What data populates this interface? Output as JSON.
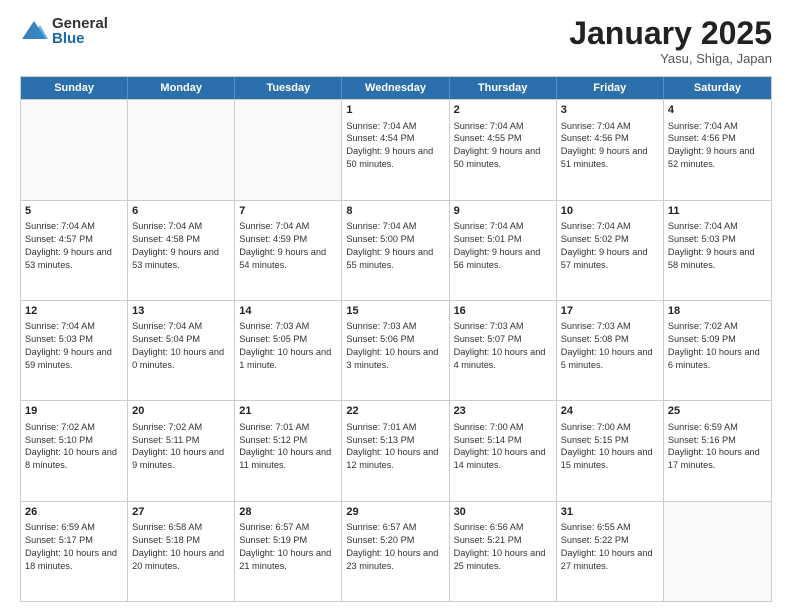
{
  "logo": {
    "general": "General",
    "blue": "Blue"
  },
  "title": "January 2025",
  "subtitle": "Yasu, Shiga, Japan",
  "headers": [
    "Sunday",
    "Monday",
    "Tuesday",
    "Wednesday",
    "Thursday",
    "Friday",
    "Saturday"
  ],
  "weeks": [
    [
      {
        "day": "",
        "text": ""
      },
      {
        "day": "",
        "text": ""
      },
      {
        "day": "",
        "text": ""
      },
      {
        "day": "1",
        "text": "Sunrise: 7:04 AM\nSunset: 4:54 PM\nDaylight: 9 hours and 50 minutes."
      },
      {
        "day": "2",
        "text": "Sunrise: 7:04 AM\nSunset: 4:55 PM\nDaylight: 9 hours and 50 minutes."
      },
      {
        "day": "3",
        "text": "Sunrise: 7:04 AM\nSunset: 4:56 PM\nDaylight: 9 hours and 51 minutes."
      },
      {
        "day": "4",
        "text": "Sunrise: 7:04 AM\nSunset: 4:56 PM\nDaylight: 9 hours and 52 minutes."
      }
    ],
    [
      {
        "day": "5",
        "text": "Sunrise: 7:04 AM\nSunset: 4:57 PM\nDaylight: 9 hours and 53 minutes."
      },
      {
        "day": "6",
        "text": "Sunrise: 7:04 AM\nSunset: 4:58 PM\nDaylight: 9 hours and 53 minutes."
      },
      {
        "day": "7",
        "text": "Sunrise: 7:04 AM\nSunset: 4:59 PM\nDaylight: 9 hours and 54 minutes."
      },
      {
        "day": "8",
        "text": "Sunrise: 7:04 AM\nSunset: 5:00 PM\nDaylight: 9 hours and 55 minutes."
      },
      {
        "day": "9",
        "text": "Sunrise: 7:04 AM\nSunset: 5:01 PM\nDaylight: 9 hours and 56 minutes."
      },
      {
        "day": "10",
        "text": "Sunrise: 7:04 AM\nSunset: 5:02 PM\nDaylight: 9 hours and 57 minutes."
      },
      {
        "day": "11",
        "text": "Sunrise: 7:04 AM\nSunset: 5:03 PM\nDaylight: 9 hours and 58 minutes."
      }
    ],
    [
      {
        "day": "12",
        "text": "Sunrise: 7:04 AM\nSunset: 5:03 PM\nDaylight: 9 hours and 59 minutes."
      },
      {
        "day": "13",
        "text": "Sunrise: 7:04 AM\nSunset: 5:04 PM\nDaylight: 10 hours and 0 minutes."
      },
      {
        "day": "14",
        "text": "Sunrise: 7:03 AM\nSunset: 5:05 PM\nDaylight: 10 hours and 1 minute."
      },
      {
        "day": "15",
        "text": "Sunrise: 7:03 AM\nSunset: 5:06 PM\nDaylight: 10 hours and 3 minutes."
      },
      {
        "day": "16",
        "text": "Sunrise: 7:03 AM\nSunset: 5:07 PM\nDaylight: 10 hours and 4 minutes."
      },
      {
        "day": "17",
        "text": "Sunrise: 7:03 AM\nSunset: 5:08 PM\nDaylight: 10 hours and 5 minutes."
      },
      {
        "day": "18",
        "text": "Sunrise: 7:02 AM\nSunset: 5:09 PM\nDaylight: 10 hours and 6 minutes."
      }
    ],
    [
      {
        "day": "19",
        "text": "Sunrise: 7:02 AM\nSunset: 5:10 PM\nDaylight: 10 hours and 8 minutes."
      },
      {
        "day": "20",
        "text": "Sunrise: 7:02 AM\nSunset: 5:11 PM\nDaylight: 10 hours and 9 minutes."
      },
      {
        "day": "21",
        "text": "Sunrise: 7:01 AM\nSunset: 5:12 PM\nDaylight: 10 hours and 11 minutes."
      },
      {
        "day": "22",
        "text": "Sunrise: 7:01 AM\nSunset: 5:13 PM\nDaylight: 10 hours and 12 minutes."
      },
      {
        "day": "23",
        "text": "Sunrise: 7:00 AM\nSunset: 5:14 PM\nDaylight: 10 hours and 14 minutes."
      },
      {
        "day": "24",
        "text": "Sunrise: 7:00 AM\nSunset: 5:15 PM\nDaylight: 10 hours and 15 minutes."
      },
      {
        "day": "25",
        "text": "Sunrise: 6:59 AM\nSunset: 5:16 PM\nDaylight: 10 hours and 17 minutes."
      }
    ],
    [
      {
        "day": "26",
        "text": "Sunrise: 6:59 AM\nSunset: 5:17 PM\nDaylight: 10 hours and 18 minutes."
      },
      {
        "day": "27",
        "text": "Sunrise: 6:58 AM\nSunset: 5:18 PM\nDaylight: 10 hours and 20 minutes."
      },
      {
        "day": "28",
        "text": "Sunrise: 6:57 AM\nSunset: 5:19 PM\nDaylight: 10 hours and 21 minutes."
      },
      {
        "day": "29",
        "text": "Sunrise: 6:57 AM\nSunset: 5:20 PM\nDaylight: 10 hours and 23 minutes."
      },
      {
        "day": "30",
        "text": "Sunrise: 6:56 AM\nSunset: 5:21 PM\nDaylight: 10 hours and 25 minutes."
      },
      {
        "day": "31",
        "text": "Sunrise: 6:55 AM\nSunset: 5:22 PM\nDaylight: 10 hours and 27 minutes."
      },
      {
        "day": "",
        "text": ""
      }
    ]
  ]
}
